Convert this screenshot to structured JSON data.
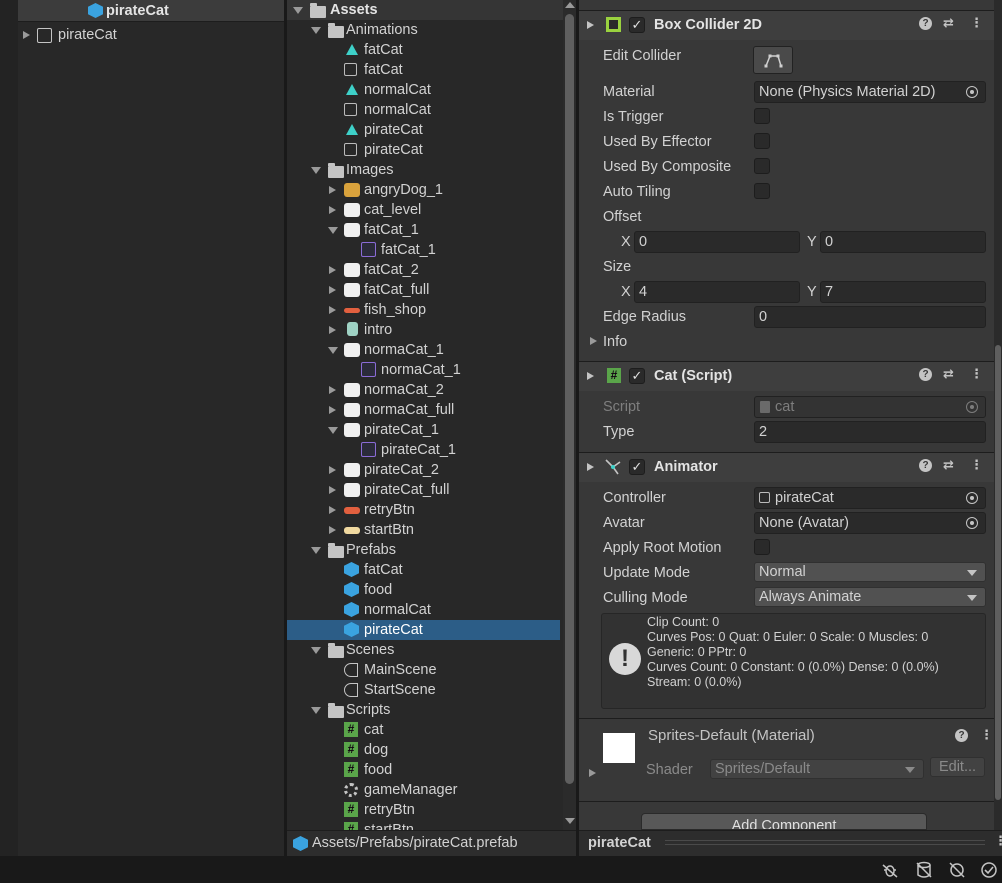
{
  "hierarchy": {
    "header_title": "pirateCat",
    "root_item": "pirateCat"
  },
  "project": {
    "root": "Assets",
    "items": [
      {
        "label": "Animations",
        "depth": 1,
        "icon": "folder-open-icon",
        "arrow": "down"
      },
      {
        "label": "fatCat",
        "depth": 2,
        "icon": "animation-clip-icon"
      },
      {
        "label": "fatCat",
        "depth": 2,
        "icon": "animator-controller-icon"
      },
      {
        "label": "normalCat",
        "depth": 2,
        "icon": "animation-clip-icon"
      },
      {
        "label": "normalCat",
        "depth": 2,
        "icon": "animator-controller-icon"
      },
      {
        "label": "pirateCat",
        "depth": 2,
        "icon": "animation-clip-icon"
      },
      {
        "label": "pirateCat",
        "depth": 2,
        "icon": "animator-controller-icon"
      },
      {
        "label": "Images",
        "depth": 1,
        "icon": "folder-open-icon",
        "arrow": "down"
      },
      {
        "label": "angryDog_1",
        "depth": 2,
        "icon": "sprite-dog-icon",
        "arrow": "right"
      },
      {
        "label": "cat_level",
        "depth": 2,
        "icon": "sprite-cat-icon",
        "arrow": "right"
      },
      {
        "label": "fatCat_1",
        "depth": 2,
        "icon": "sprite-cat-icon",
        "arrow": "down"
      },
      {
        "label": "fatCat_1",
        "depth": 3,
        "icon": "sub-sprite-icon"
      },
      {
        "label": "fatCat_2",
        "depth": 2,
        "icon": "sprite-cat-icon",
        "arrow": "right"
      },
      {
        "label": "fatCat_full",
        "depth": 2,
        "icon": "sprite-cat-icon",
        "arrow": "right"
      },
      {
        "label": "fish_shop",
        "depth": 2,
        "icon": "sprite-fish-icon",
        "arrow": "right"
      },
      {
        "label": "intro",
        "depth": 2,
        "icon": "sprite-intro-icon",
        "arrow": "right"
      },
      {
        "label": "normaCat_1",
        "depth": 2,
        "icon": "sprite-cat-icon",
        "arrow": "down"
      },
      {
        "label": "normaCat_1",
        "depth": 3,
        "icon": "sub-sprite-icon"
      },
      {
        "label": "normaCat_2",
        "depth": 2,
        "icon": "sprite-cat-icon",
        "arrow": "right"
      },
      {
        "label": "normaCat_full",
        "depth": 2,
        "icon": "sprite-cat-icon",
        "arrow": "right"
      },
      {
        "label": "pirateCat_1",
        "depth": 2,
        "icon": "sprite-cat-icon",
        "arrow": "down"
      },
      {
        "label": "pirateCat_1",
        "depth": 3,
        "icon": "sub-sprite-icon"
      },
      {
        "label": "pirateCat_2",
        "depth": 2,
        "icon": "sprite-cat-icon",
        "arrow": "right"
      },
      {
        "label": "pirateCat_full",
        "depth": 2,
        "icon": "sprite-cat-icon",
        "arrow": "right"
      },
      {
        "label": "retryBtn",
        "depth": 2,
        "icon": "sprite-retry-icon",
        "arrow": "right"
      },
      {
        "label": "startBtn",
        "depth": 2,
        "icon": "sprite-start-icon",
        "arrow": "right"
      },
      {
        "label": "Prefabs",
        "depth": 1,
        "icon": "folder-open-icon",
        "arrow": "down"
      },
      {
        "label": "fatCat",
        "depth": 2,
        "icon": "prefab-icon"
      },
      {
        "label": "food",
        "depth": 2,
        "icon": "prefab-icon"
      },
      {
        "label": "normalCat",
        "depth": 2,
        "icon": "prefab-icon"
      },
      {
        "label": "pirateCat",
        "depth": 2,
        "icon": "prefab-icon",
        "selected": true
      },
      {
        "label": "Scenes",
        "depth": 1,
        "icon": "folder-open-icon",
        "arrow": "down"
      },
      {
        "label": "MainScene",
        "depth": 2,
        "icon": "scene-icon"
      },
      {
        "label": "StartScene",
        "depth": 2,
        "icon": "scene-icon"
      },
      {
        "label": "Scripts",
        "depth": 1,
        "icon": "folder-open-icon",
        "arrow": "down"
      },
      {
        "label": "cat",
        "depth": 2,
        "icon": "script-icon"
      },
      {
        "label": "dog",
        "depth": 2,
        "icon": "script-icon"
      },
      {
        "label": "food",
        "depth": 2,
        "icon": "script-icon"
      },
      {
        "label": "gameManager",
        "depth": 2,
        "icon": "gear-icon"
      },
      {
        "label": "retryBtn",
        "depth": 2,
        "icon": "script-icon"
      },
      {
        "label": "startBtn",
        "depth": 2,
        "icon": "script-icon"
      }
    ],
    "path": "Assets/Prefabs/pirateCat.prefab"
  },
  "inspector": {
    "box_collider": {
      "title": "Box Collider 2D",
      "edit_collider": "Edit Collider",
      "material_label": "Material",
      "material_value": "None (Physics Material 2D)",
      "is_trigger": "Is Trigger",
      "used_by_effector": "Used By Effector",
      "used_by_composite": "Used By Composite",
      "auto_tiling": "Auto Tiling",
      "offset_label": "Offset",
      "offset_x": "0",
      "offset_y": "0",
      "size_label": "Size",
      "size_x": "4",
      "size_y": "7",
      "x": "X",
      "y": "Y",
      "edge_radius_label": "Edge Radius",
      "edge_radius_value": "0",
      "info": "Info"
    },
    "cat_script": {
      "title": "Cat (Script)",
      "script_label": "Script",
      "script_value": "cat",
      "type_label": "Type",
      "type_value": "2"
    },
    "animator": {
      "title": "Animator",
      "controller_label": "Controller",
      "controller_value": "pirateCat",
      "avatar_label": "Avatar",
      "avatar_value": "None (Avatar)",
      "apply_root_motion": "Apply Root Motion",
      "update_mode_label": "Update Mode",
      "update_mode_value": "Normal",
      "culling_mode_label": "Culling Mode",
      "culling_mode_value": "Always Animate",
      "info_lines": [
        "Clip Count: 0",
        "Curves Pos: 0 Quat: 0 Euler: 0 Scale: 0 Muscles: 0",
        "Generic: 0 PPtr: 0",
        "Curves Count: 0 Constant: 0 (0.0%) Dense: 0 (0.0%)",
        "Stream: 0 (0.0%)"
      ]
    },
    "material": {
      "title": "Sprites-Default (Material)",
      "shader_label": "Shader",
      "shader_value": "Sprites/Default",
      "edit_label": "Edit..."
    },
    "add_component": "Add Component",
    "footer_title": "pirateCat"
  },
  "colors": {
    "panel": "#282828",
    "inspector_bg": "#383838",
    "selection": "#2c5d87",
    "prefab_blue": "#3aa3e0"
  }
}
